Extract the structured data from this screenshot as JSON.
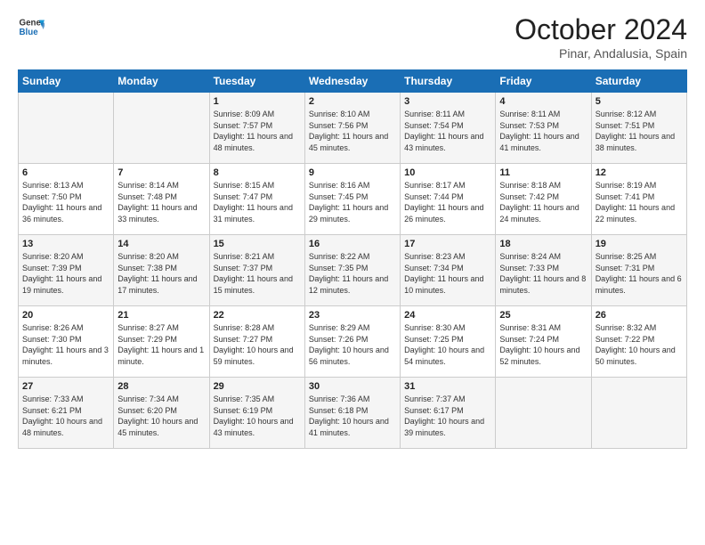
{
  "header": {
    "logo_line1": "General",
    "logo_line2": "Blue",
    "month": "October 2024",
    "location": "Pinar, Andalusia, Spain"
  },
  "weekdays": [
    "Sunday",
    "Monday",
    "Tuesday",
    "Wednesday",
    "Thursday",
    "Friday",
    "Saturday"
  ],
  "weeks": [
    [
      {
        "day": "",
        "info": ""
      },
      {
        "day": "",
        "info": ""
      },
      {
        "day": "1",
        "info": "Sunrise: 8:09 AM\nSunset: 7:57 PM\nDaylight: 11 hours and 48 minutes."
      },
      {
        "day": "2",
        "info": "Sunrise: 8:10 AM\nSunset: 7:56 PM\nDaylight: 11 hours and 45 minutes."
      },
      {
        "day": "3",
        "info": "Sunrise: 8:11 AM\nSunset: 7:54 PM\nDaylight: 11 hours and 43 minutes."
      },
      {
        "day": "4",
        "info": "Sunrise: 8:11 AM\nSunset: 7:53 PM\nDaylight: 11 hours and 41 minutes."
      },
      {
        "day": "5",
        "info": "Sunrise: 8:12 AM\nSunset: 7:51 PM\nDaylight: 11 hours and 38 minutes."
      }
    ],
    [
      {
        "day": "6",
        "info": "Sunrise: 8:13 AM\nSunset: 7:50 PM\nDaylight: 11 hours and 36 minutes."
      },
      {
        "day": "7",
        "info": "Sunrise: 8:14 AM\nSunset: 7:48 PM\nDaylight: 11 hours and 33 minutes."
      },
      {
        "day": "8",
        "info": "Sunrise: 8:15 AM\nSunset: 7:47 PM\nDaylight: 11 hours and 31 minutes."
      },
      {
        "day": "9",
        "info": "Sunrise: 8:16 AM\nSunset: 7:45 PM\nDaylight: 11 hours and 29 minutes."
      },
      {
        "day": "10",
        "info": "Sunrise: 8:17 AM\nSunset: 7:44 PM\nDaylight: 11 hours and 26 minutes."
      },
      {
        "day": "11",
        "info": "Sunrise: 8:18 AM\nSunset: 7:42 PM\nDaylight: 11 hours and 24 minutes."
      },
      {
        "day": "12",
        "info": "Sunrise: 8:19 AM\nSunset: 7:41 PM\nDaylight: 11 hours and 22 minutes."
      }
    ],
    [
      {
        "day": "13",
        "info": "Sunrise: 8:20 AM\nSunset: 7:39 PM\nDaylight: 11 hours and 19 minutes."
      },
      {
        "day": "14",
        "info": "Sunrise: 8:20 AM\nSunset: 7:38 PM\nDaylight: 11 hours and 17 minutes."
      },
      {
        "day": "15",
        "info": "Sunrise: 8:21 AM\nSunset: 7:37 PM\nDaylight: 11 hours and 15 minutes."
      },
      {
        "day": "16",
        "info": "Sunrise: 8:22 AM\nSunset: 7:35 PM\nDaylight: 11 hours and 12 minutes."
      },
      {
        "day": "17",
        "info": "Sunrise: 8:23 AM\nSunset: 7:34 PM\nDaylight: 11 hours and 10 minutes."
      },
      {
        "day": "18",
        "info": "Sunrise: 8:24 AM\nSunset: 7:33 PM\nDaylight: 11 hours and 8 minutes."
      },
      {
        "day": "19",
        "info": "Sunrise: 8:25 AM\nSunset: 7:31 PM\nDaylight: 11 hours and 6 minutes."
      }
    ],
    [
      {
        "day": "20",
        "info": "Sunrise: 8:26 AM\nSunset: 7:30 PM\nDaylight: 11 hours and 3 minutes."
      },
      {
        "day": "21",
        "info": "Sunrise: 8:27 AM\nSunset: 7:29 PM\nDaylight: 11 hours and 1 minute."
      },
      {
        "day": "22",
        "info": "Sunrise: 8:28 AM\nSunset: 7:27 PM\nDaylight: 10 hours and 59 minutes."
      },
      {
        "day": "23",
        "info": "Sunrise: 8:29 AM\nSunset: 7:26 PM\nDaylight: 10 hours and 56 minutes."
      },
      {
        "day": "24",
        "info": "Sunrise: 8:30 AM\nSunset: 7:25 PM\nDaylight: 10 hours and 54 minutes."
      },
      {
        "day": "25",
        "info": "Sunrise: 8:31 AM\nSunset: 7:24 PM\nDaylight: 10 hours and 52 minutes."
      },
      {
        "day": "26",
        "info": "Sunrise: 8:32 AM\nSunset: 7:22 PM\nDaylight: 10 hours and 50 minutes."
      }
    ],
    [
      {
        "day": "27",
        "info": "Sunrise: 7:33 AM\nSunset: 6:21 PM\nDaylight: 10 hours and 48 minutes."
      },
      {
        "day": "28",
        "info": "Sunrise: 7:34 AM\nSunset: 6:20 PM\nDaylight: 10 hours and 45 minutes."
      },
      {
        "day": "29",
        "info": "Sunrise: 7:35 AM\nSunset: 6:19 PM\nDaylight: 10 hours and 43 minutes."
      },
      {
        "day": "30",
        "info": "Sunrise: 7:36 AM\nSunset: 6:18 PM\nDaylight: 10 hours and 41 minutes."
      },
      {
        "day": "31",
        "info": "Sunrise: 7:37 AM\nSunset: 6:17 PM\nDaylight: 10 hours and 39 minutes."
      },
      {
        "day": "",
        "info": ""
      },
      {
        "day": "",
        "info": ""
      }
    ]
  ]
}
